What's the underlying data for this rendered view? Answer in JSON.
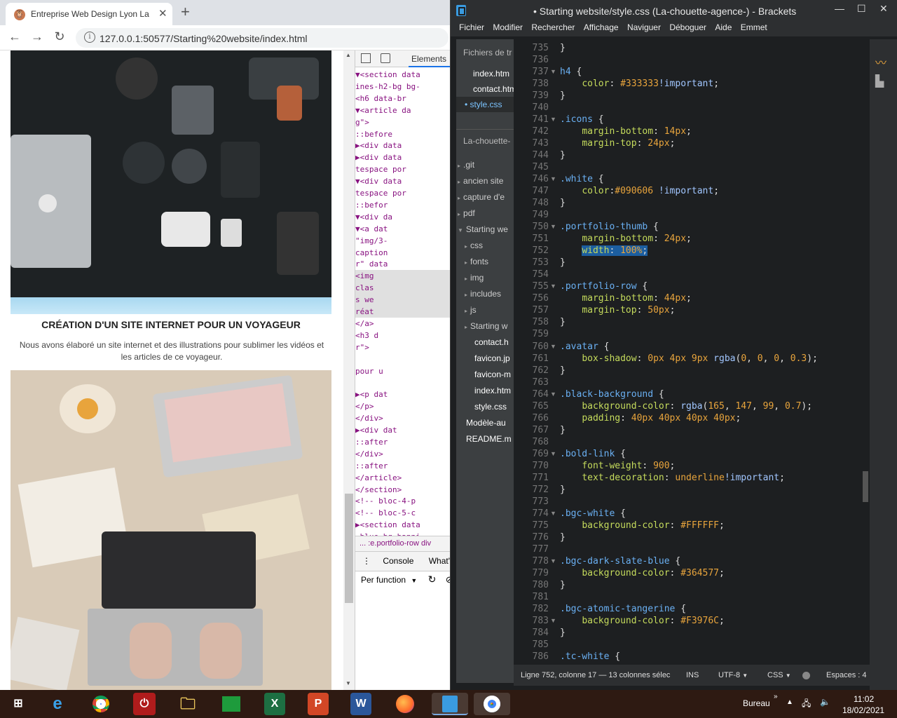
{
  "browser": {
    "tab_title": "Entreprise Web Design Lyon La chouette agence",
    "close_label": "✕",
    "new_tab_label": "+",
    "url": "127.0.0.1:50577/Starting%20website/index.html"
  },
  "page": {
    "heading": "CRÉATION D'UN SITE INTERNET POUR UN VOYAGEUR",
    "paragraph": "Nous avons élaboré un site internet et des illustrations pour sublimer les vidéos et les articles de ce voyageur."
  },
  "devtools": {
    "tab_elements": "Elements",
    "lines": [
      "▼<section data",
      "ines-h2-bg bg-",
      "    <h6 data-br",
      "  ▼<article da",
      "g\">",
      "      ::before",
      "    ▶<div data",
      "    ▶<div data",
      "    tespace por",
      "    ▼<div data",
      "    tespace por",
      "        ::befor",
      "      ▼<div da",
      "        ▼<a dat",
      "        \"img/3-",
      "        caption",
      "        r\" data",
      "          <img",
      "          clas",
      "          s we",
      "          réat",
      "        </a>",
      "        <h3 d",
      "        r\">",
      "",
      "        pour u",
      "",
      "      ▶<p dat",
      "      </p>",
      "      </div>",
      "     ▶<div dat",
      "       ::after",
      "      </div>",
      "      ::after",
      "    </article>",
      "  </section>",
      "  <!-- bloc-4-p",
      "  <!-- bloc-5-c",
      "▶<section data",
      "-blue bg-banni"
    ],
    "breadcrumb": "...  :e.portfolio-row  div",
    "console_tab": "Console",
    "whats_new_tab": "What's",
    "per_function": "Per function"
  },
  "brackets": {
    "title": "• Starting website/style.css (La-chouette-agence-) - Brackets",
    "menu": [
      "Fichier",
      "Modifier",
      "Rechercher",
      "Affichage",
      "Naviguer",
      "Déboguer",
      "Aide",
      "Emmet"
    ],
    "working_files_label": "Fichiers de tr",
    "working_files": [
      "index.htm",
      "contact.htm",
      "style.css"
    ],
    "project_label": "La-chouette-",
    "tree": [
      ".git",
      "ancien site",
      "capture d'e",
      "pdf",
      "Starting we",
      "css",
      "fonts",
      "img",
      "includes",
      "js",
      "Starting w",
      "contact.h",
      "favicon.jp",
      "favicon-m",
      "index.htm",
      "style.css",
      "Modèle-au",
      "README.m"
    ],
    "line_numbers": [
      "735",
      "736",
      "737",
      "738",
      "739",
      "740",
      "741",
      "742",
      "743",
      "744",
      "745",
      "746",
      "747",
      "748",
      "749",
      "750",
      "751",
      "752",
      "753",
      "754",
      "755",
      "756",
      "757",
      "758",
      "759",
      "760",
      "761",
      "762",
      "763",
      "764",
      "765",
      "766",
      "767",
      "768",
      "769",
      "770",
      "771",
      "772",
      "773",
      "774",
      "775",
      "776",
      "777",
      "778",
      "779",
      "780",
      "781",
      "782",
      "783",
      "784",
      "785",
      "786"
    ],
    "status": {
      "position": "Ligne 752, colonne 17 — 13 colonnes sélec",
      "ins": "INS",
      "encoding": "UTF-8",
      "language": "CSS",
      "spaces": "Espaces : 4"
    }
  },
  "taskbar": {
    "bureau": "Bureau",
    "time": "11:02",
    "date": "18/02/2021"
  },
  "colors": {
    "selector": "#6ab0f3",
    "property": "#c5db5c",
    "value_number": "#e8a43c",
    "keyword": "#a1c6ff",
    "selection": "#1c5ea0"
  }
}
